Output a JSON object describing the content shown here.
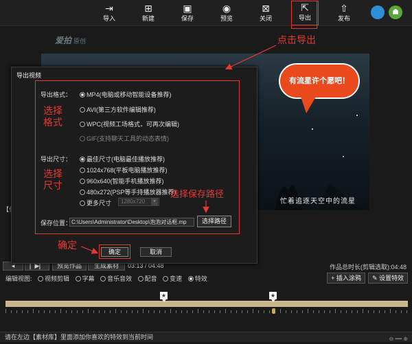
{
  "toolbar": {
    "import": "导入",
    "new": "新建",
    "save": "保存",
    "preview": "预览",
    "close": "关闭",
    "export": "导出",
    "publish": "发布"
  },
  "video": {
    "logo": "爱拍",
    "logo_sub": "原创",
    "bubble_text": "有流星许个愿吧！",
    "caption": "忙着追逐天空中的流星"
  },
  "dialog": {
    "title": "导出视频",
    "format_label": "导出格式：",
    "formats": [
      {
        "label": "MP4(电脑或移动智能设备推荐)",
        "selected": true
      },
      {
        "label": "AVI(第三方软件编辑推荐)",
        "selected": false
      },
      {
        "label": "WPC(视频工场格式，可再次编辑)",
        "selected": false
      },
      {
        "label": "GIF(支持聊天工具的动态表情)",
        "selected": false
      }
    ],
    "size_label": "导出尺寸：",
    "sizes": [
      {
        "label": "最佳尺寸(电脑最佳播放推荐)",
        "selected": true
      },
      {
        "label": "1024x768(平板电脑播放推荐)",
        "selected": false
      },
      {
        "label": "960x640(智能手机播放推荐)",
        "selected": false
      },
      {
        "label": "480x272(PSP等手持播放器推荐)",
        "selected": false
      },
      {
        "label": "更多尺寸",
        "selected": false
      }
    ],
    "more_size_value": "1280x720",
    "save_location_label": "保存位置：",
    "save_path": "C:\\Users\\Administrator\\Desktop\\泡泡对话框.mp",
    "choose_path_button": "选择路径",
    "ok_button": "确定",
    "cancel_button": "取消"
  },
  "annotations": {
    "click_export": "点击导出",
    "choose_format": "选择\n格式",
    "choose_size": "选择\n尺寸",
    "choose_save_path": "选择保存路径",
    "confirm": "确定"
  },
  "player": {
    "fragment": "【作品 1】",
    "preview_work": "预览作品",
    "generate_material": "生成素材",
    "time": "03:13 / 04:48",
    "total_duration": "作品总时长(剪辑选取):04:48"
  },
  "edit_view": {
    "label": "编辑视图:",
    "options": [
      {
        "label": "视频剪辑",
        "selected": false
      },
      {
        "label": "字幕",
        "selected": false
      },
      {
        "label": "音乐音效",
        "selected": false
      },
      {
        "label": "配音",
        "selected": false
      },
      {
        "label": "变速",
        "selected": false
      },
      {
        "label": "特效",
        "selected": true
      }
    ],
    "insert_graffiti": "插入涂鸦",
    "set_effect": "设置特效"
  },
  "status_bar": "请在左边【素材库】里面添加你喜欢的特效到当前时间",
  "colors": {
    "annotation_red": "#e53935",
    "bubble_orange": "#e8491d",
    "track": "#c9b88e"
  }
}
